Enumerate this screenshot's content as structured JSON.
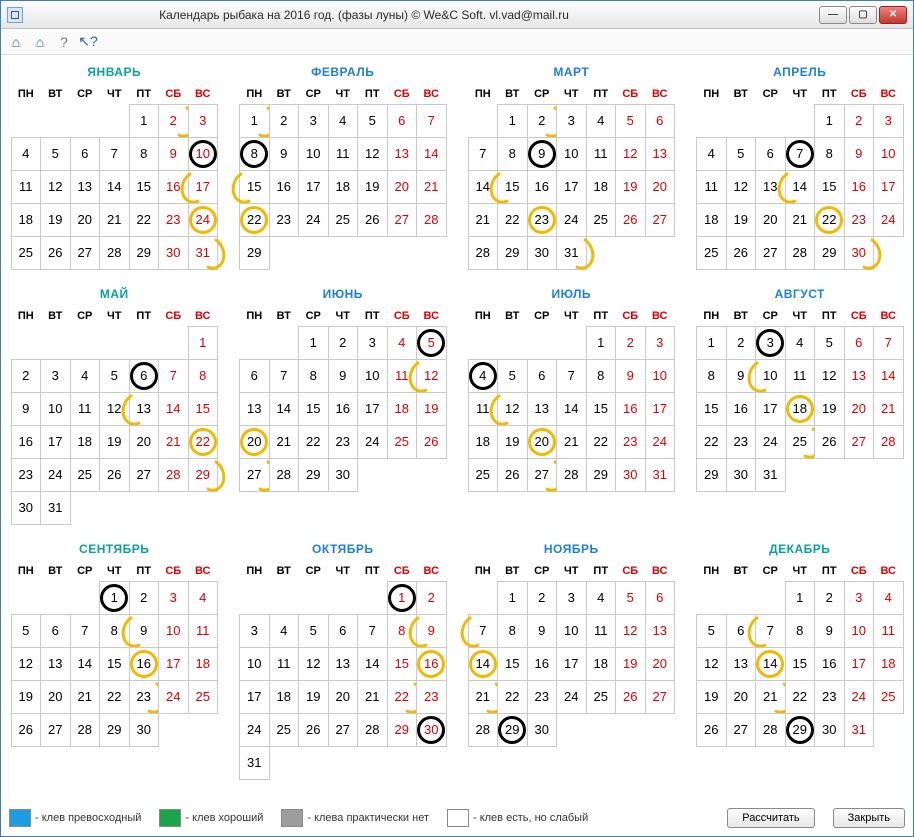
{
  "title": "Календарь рыбака на 2016 год. (фазы луны) © We&C Soft. vl.vad@mail.ru",
  "dow": [
    "ПН",
    "ВТ",
    "СР",
    "ЧТ",
    "ПТ",
    "СБ",
    "ВС"
  ],
  "legend": {
    "great": "- клев превосходный",
    "good": "- клев хороший",
    "none": "- клева практически нет",
    "weak": "- клев есть, но слабый"
  },
  "buttons": {
    "calc": "Рассчитать",
    "close": "Закрыть"
  },
  "colors": {
    "great": "#1e9de0",
    "good": "#1aa54a",
    "none": "#9d9d9d",
    "weak": "#ffffff",
    "month_teal": "#0aa0a0",
    "month_blue": "#1e7fd6",
    "weekend": "#d00000"
  },
  "months": [
    {
      "name": "ЯНВАРЬ",
      "color": "teal",
      "offset": 4,
      "days": 31,
      "moons": {
        "2": "lq",
        "10": "nm",
        "17": "fq",
        "24": "fm",
        "31": "lq"
      }
    },
    {
      "name": "ФЕВРАЛЬ",
      "color": "blue",
      "offset": 0,
      "days": 29,
      "moons": {
        "1": "lq",
        "8": "nm",
        "15": "fq",
        "22": "fm"
      }
    },
    {
      "name": "МАРТ",
      "color": "blue",
      "offset": 1,
      "days": 31,
      "moons": {
        "2": "lq",
        "9": "nm",
        "15": "fq",
        "23": "fm",
        "31": "lq"
      }
    },
    {
      "name": "АПРЕЛЬ",
      "color": "blue",
      "offset": 4,
      "days": 30,
      "moons": {
        "7": "nm",
        "14": "fq",
        "22": "fm",
        "30": "lq"
      }
    },
    {
      "name": "МАЙ",
      "color": "teal",
      "offset": 6,
      "days": 31,
      "moons": {
        "6": "nm",
        "13": "fq",
        "22": "fm",
        "29": "lq"
      }
    },
    {
      "name": "ИЮНЬ",
      "color": "blue",
      "offset": 2,
      "days": 30,
      "moons": {
        "5": "nm",
        "12": "fq",
        "20": "fm",
        "27": "lq"
      }
    },
    {
      "name": "ИЮЛЬ",
      "color": "blue",
      "offset": 4,
      "days": 31,
      "moons": {
        "4": "nm",
        "12": "fq",
        "20": "fm",
        "27": "lq"
      }
    },
    {
      "name": "АВГУСТ",
      "color": "blue",
      "offset": 0,
      "days": 31,
      "moons": {
        "3": "nm",
        "10": "fq",
        "18": "fm",
        "25": "lq"
      }
    },
    {
      "name": "СЕНТЯБРЬ",
      "color": "teal",
      "offset": 3,
      "days": 30,
      "moons": {
        "1": "nm",
        "9": "fq",
        "16": "fm",
        "23": "lq"
      }
    },
    {
      "name": "ОКТЯБРЬ",
      "color": "blue",
      "offset": 5,
      "days": 31,
      "moons": {
        "1": "nm",
        "9": "fq",
        "16": "fm",
        "22": "lq",
        "30": "nm"
      }
    },
    {
      "name": "НОЯБРЬ",
      "color": "blue",
      "offset": 1,
      "days": 30,
      "moons": {
        "7": "fq",
        "14": "fm",
        "21": "lq",
        "29": "nm"
      }
    },
    {
      "name": "ДЕКАБРЬ",
      "color": "teal",
      "offset": 3,
      "days": 31,
      "moons": {
        "7": "fq",
        "14": "fm",
        "21": "lq",
        "29": "nm"
      }
    }
  ]
}
